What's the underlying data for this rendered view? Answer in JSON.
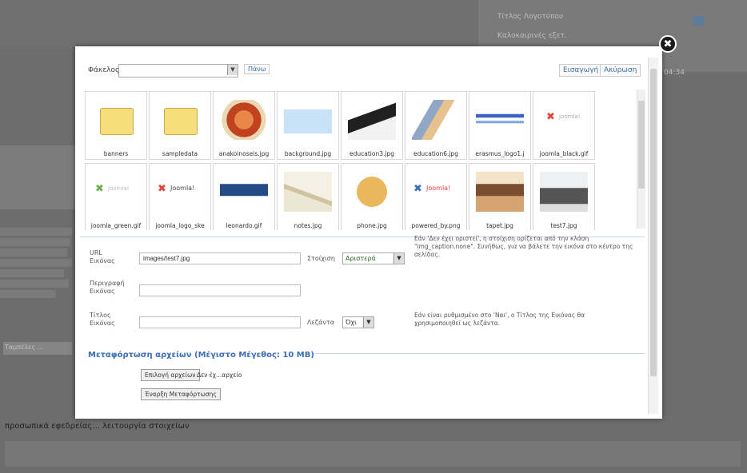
{
  "background": {
    "right_rows": [
      "Τίτλος Λογοτύπου",
      "Καλοκαιρινές εξετ."
    ],
    "right_value": "04:34",
    "left_select": "Ταμπέλες ...",
    "bottom_note": "προσωπικά εφεδρείας... λειτουργία στοιχείων"
  },
  "modal": {
    "folder_label": "Φάκελος /",
    "up_label": "Πάνω",
    "insert_label": "Εισαγωγή",
    "cancel_label": "Ακύρωση",
    "close_glyph": "✖",
    "thumbnails": [
      {
        "name": "banners",
        "kind": "folder"
      },
      {
        "name": "sampledata",
        "kind": "folder"
      },
      {
        "name": "anakoinoseis.jpg",
        "kind": "image"
      },
      {
        "name": "background.jpg",
        "kind": "image"
      },
      {
        "name": "education3.jpg",
        "kind": "image"
      },
      {
        "name": "education6.jpg",
        "kind": "image"
      },
      {
        "name": "erasmus_logo1.j",
        "kind": "image"
      },
      {
        "name": "joomla_black.gif",
        "kind": "image"
      },
      {
        "name": "joomla_green.gif",
        "kind": "image"
      },
      {
        "name": "joomla_logo_ske",
        "kind": "image"
      },
      {
        "name": "leonardo.gif",
        "kind": "image"
      },
      {
        "name": "notes.jpg",
        "kind": "image"
      },
      {
        "name": "phone.jpg",
        "kind": "image"
      },
      {
        "name": "powered_by.png",
        "kind": "image"
      },
      {
        "name": "tapet.jpg",
        "kind": "image"
      },
      {
        "name": "test7.jpg",
        "kind": "image"
      }
    ],
    "url_label": "URL Εικόνας",
    "url_value": "images/test7.jpg",
    "align_label": "Στοίχιση",
    "align_value": "Αριστερά",
    "align_help": "Εάν 'Δεν έχει οριστεί', η στοίχιση ορίζεται από την κλάση \"img_caption.none\". Συνήθως, για να βάλετε την εικόνα στο κέντρο της σελίδας.",
    "desc_label": "Περιγραφή Εικόνας",
    "desc_value": "",
    "title_label": "Τίτλος Εικόνας",
    "title_value": "",
    "caption_label": "Λεζάντα",
    "caption_value": "Όχι",
    "caption_help": "Εάν είναι ρυθμισμένο στο 'Ναι', ο Τίτλος της Εικόνας θα χρησιμοποιηθεί ως λεζάντα.",
    "upload_title": "Μεταφόρτωση αρχείων (Μέγιστο Μέγεθος: 10 MB)",
    "choose_files_label": "Επιλογή αρχείων",
    "no_file_label": "Δεν έχ...αρχείο",
    "start_upload_label": "Έναρξη Μεταφόρτωσης"
  }
}
